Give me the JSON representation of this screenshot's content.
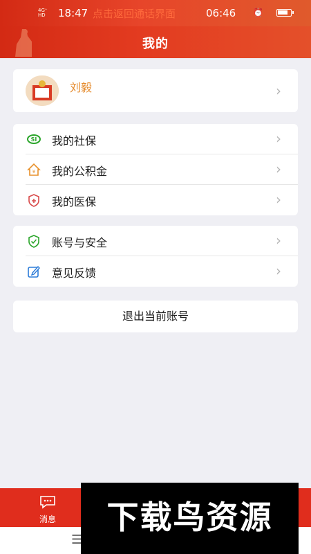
{
  "status_bar": {
    "signal_text": "4G⁺HD\n4G⁺HD",
    "time": "18:47",
    "call_banner": "点击返回通话界面",
    "call_time": "06:46"
  },
  "header": {
    "title": "我的"
  },
  "profile": {
    "name": "刘毅"
  },
  "menu_group_1": [
    {
      "label": "我的社保",
      "icon": "social-insurance-icon",
      "color": "#2aa52a"
    },
    {
      "label": "我的公积金",
      "icon": "house-fund-icon",
      "color": "#e8912b"
    },
    {
      "label": "我的医保",
      "icon": "medical-insurance-icon",
      "color": "#d84a4a"
    }
  ],
  "menu_group_2": [
    {
      "label": "账号与安全",
      "icon": "shield-check-icon",
      "color": "#2aa52a"
    },
    {
      "label": "意见反馈",
      "icon": "edit-icon",
      "color": "#2b7bd8"
    }
  ],
  "logout": {
    "label": "退出当前账号"
  },
  "tabbar": {
    "messages_label": "消息"
  },
  "watermark": {
    "text": "下载鸟资源"
  },
  "colors": {
    "brand_red": "#e02d1d",
    "name_orange": "#e58a2b",
    "background": "#efeff4"
  }
}
